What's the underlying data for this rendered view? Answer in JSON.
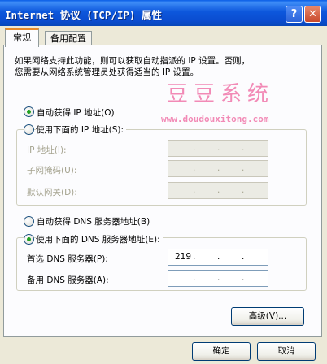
{
  "window": {
    "title": "Internet 协议 (TCP/IP) 属性",
    "help_label": "?",
    "close_label": "✕"
  },
  "tabs": [
    {
      "label": "常规",
      "active": true
    },
    {
      "label": "备用配置",
      "active": false
    }
  ],
  "description": {
    "line1": "如果网络支持此功能，则可以获取自动指派的 IP 设置。否则，",
    "line2": "您需要从网络系统管理员处获得适当的 IP 设置。"
  },
  "watermark": {
    "text": "豆豆系统",
    "url": "www.doudouxitong.com"
  },
  "ip_section": {
    "auto_option": {
      "label": "自动获得 IP 地址(O)",
      "selected": true
    },
    "manual_option": {
      "label": "使用下面的 IP 地址(S):",
      "selected": false
    },
    "fields": [
      {
        "label": "IP 地址(I):",
        "value": [
          "",
          "",
          "",
          ""
        ],
        "enabled": false
      },
      {
        "label": "子网掩码(U):",
        "value": [
          "",
          "",
          "",
          ""
        ],
        "enabled": false
      },
      {
        "label": "默认网关(D):",
        "value": [
          "",
          "",
          "",
          ""
        ],
        "enabled": false
      }
    ]
  },
  "dns_section": {
    "auto_option": {
      "label": "自动获得 DNS 服务器地址(B)",
      "selected": false
    },
    "manual_option": {
      "label": "使用下面的 DNS 服务器地址(E):",
      "selected": true
    },
    "fields": [
      {
        "label": "首选 DNS 服务器(P):",
        "value": [
          "219",
          "",
          "",
          ""
        ],
        "enabled": true
      },
      {
        "label": "备用 DNS 服务器(A):",
        "value": [
          "",
          "",
          "",
          ""
        ],
        "enabled": true
      }
    ]
  },
  "buttons": {
    "advanced": "高级(V)...",
    "ok": "确定",
    "cancel": "取消"
  },
  "colors": {
    "title_bar": "#0A4CD0",
    "dialog_bg": "#ECE9D8",
    "radio_dot": "#22A122",
    "watermark": "#F28AB6",
    "tab_highlight": "#E68B2C"
  }
}
